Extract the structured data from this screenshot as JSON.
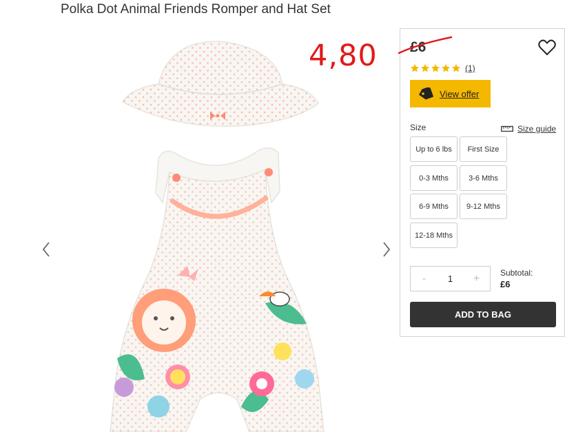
{
  "product": {
    "title": "Polka Dot Animal Friends Romper and Hat Set",
    "new_price": "4,80",
    "old_price": "£6",
    "rating": 5,
    "review_count": "(1)",
    "offer_label": "View offer",
    "size_label": "Size",
    "size_guide_label": "Size guide",
    "sizes": [
      "Up to 6 lbs",
      "First Size",
      "0-3 Mths",
      "3-6 Mths",
      "6-9 Mths",
      "9-12 Mths",
      "12-18 Mths"
    ],
    "quantity": "1",
    "qty_minus": "-",
    "qty_plus": "+",
    "subtotal_label": "Subtotal:",
    "subtotal_value": "£6",
    "add_to_bag": "ADD TO BAG"
  },
  "icons": {
    "wishlist": "heart-icon",
    "offer": "tag-icon",
    "size_guide": "ruler-icon",
    "prev": "chevron-left-icon",
    "next": "chevron-right-icon",
    "star": "star-icon"
  },
  "colors": {
    "new_price": "#e01b1b",
    "strike": "#e01b1b",
    "offer_button": "#f5b800",
    "stars": "#f5b800",
    "add_button": "#333333",
    "dots": "#ff9d88"
  }
}
